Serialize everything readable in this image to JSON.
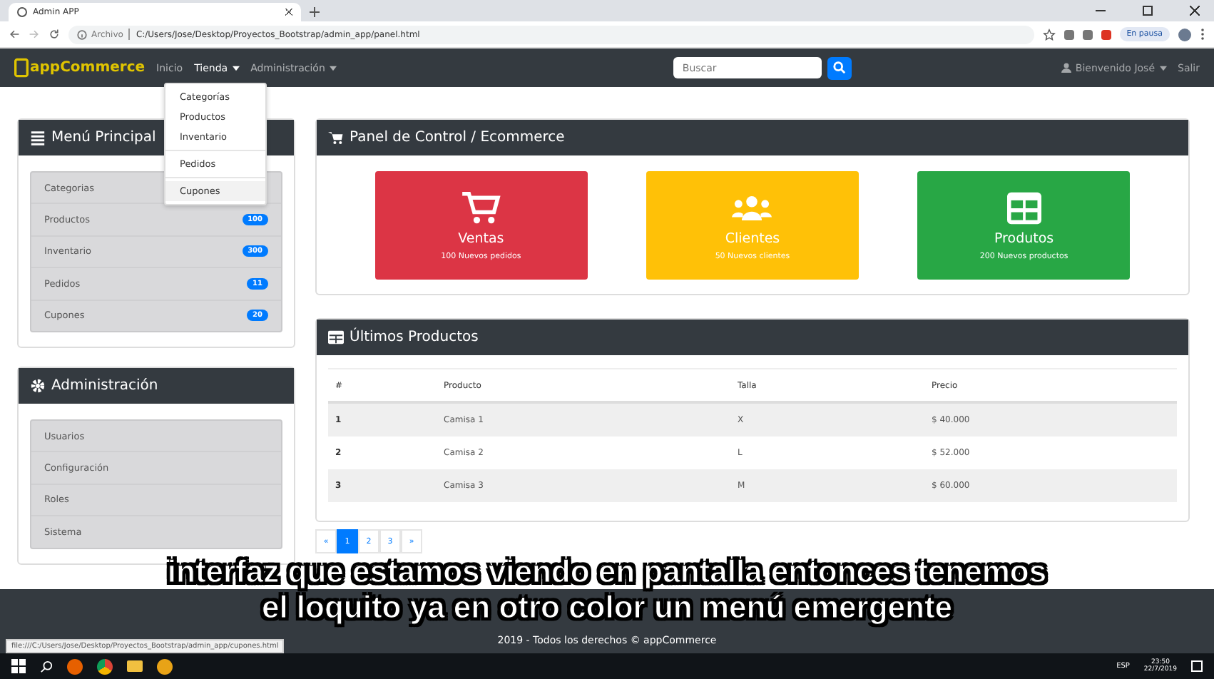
{
  "browser": {
    "tab_title": "Admin APP",
    "address_prefix": "Archivo",
    "url": "C:/Users/Jose/Desktop/Proyectos_Bootstrap/admin_app/panel.html",
    "profile_label": "En pausa"
  },
  "navbar": {
    "brand": "appCommerce",
    "links": [
      {
        "label": "Inicio",
        "dropdown": false,
        "selected": false
      },
      {
        "label": "Tienda",
        "dropdown": true,
        "selected": true
      },
      {
        "label": "Administración",
        "dropdown": true,
        "selected": false
      }
    ],
    "search": {
      "placeholder": "Buscar"
    },
    "user": "Bienvenido José",
    "logout": "Salir"
  },
  "dropdown": {
    "items": [
      {
        "label": "Categorías",
        "divider_before": false,
        "hovered": false
      },
      {
        "label": "Productos",
        "divider_before": false,
        "hovered": false
      },
      {
        "label": "Inventario",
        "divider_before": false,
        "hovered": false
      },
      {
        "label": "Pedidos",
        "divider_before": true,
        "hovered": false
      },
      {
        "label": "Cupones",
        "divider_before": true,
        "hovered": true
      }
    ]
  },
  "sidebar": [
    {
      "title": "Menú Principal",
      "items": [
        {
          "label": "Categorias"
        },
        {
          "label": "Productos",
          "badge": "100"
        },
        {
          "label": "Inventario",
          "badge": "300"
        },
        {
          "label": "Pedidos",
          "badge": "11"
        },
        {
          "label": "Cupones",
          "badge": "20"
        }
      ]
    },
    {
      "title": "Administración",
      "items": [
        {
          "label": "Usuarios"
        },
        {
          "label": "Configuración"
        },
        {
          "label": "Roles"
        },
        {
          "label": "Sistema"
        }
      ]
    }
  ],
  "panel": {
    "title": "Panel de Control / Ecommerce",
    "cards": [
      {
        "kind": "cart",
        "title": "Ventas",
        "subtitle": "100 Nuevos pedidos",
        "color": "#dc3545"
      },
      {
        "kind": "users",
        "title": "Clientes",
        "subtitle": "50 Nuevos clientes",
        "color": "#ffc107"
      },
      {
        "kind": "table",
        "title": "Produtos",
        "subtitle": "200 Nuevos productos",
        "color": "#28a745"
      }
    ]
  },
  "products": {
    "title": "Últimos Productos",
    "columns": [
      "#",
      "Producto",
      "Talla",
      "Precio"
    ],
    "rows": [
      [
        "1",
        "Camisa 1",
        "X",
        "$ 40.000"
      ],
      [
        "2",
        "Camisa 2",
        "L",
        "$ 52.000"
      ],
      [
        "3",
        "Camisa 3",
        "M",
        "$ 60.000"
      ]
    ]
  },
  "pagination": [
    {
      "label": "«",
      "selected": false
    },
    {
      "label": "1",
      "selected": true
    },
    {
      "label": "2",
      "selected": false
    },
    {
      "label": "3",
      "selected": false
    },
    {
      "label": "»",
      "selected": false
    }
  ],
  "footer": "2019 - Todos los derechos © appCommerce",
  "status_url": "file:///C:/Users/Jose/Desktop/Proyectos_Bootstrap/admin_app/cupones.html",
  "captions": [
    "interfaz que estamos viendo en pantalla entonces tenemos",
    "el loquito ya en otro color un menú emergente"
  ],
  "taskbar": {
    "language": "ESP",
    "time": "23:50",
    "date": "22/7/2019"
  }
}
